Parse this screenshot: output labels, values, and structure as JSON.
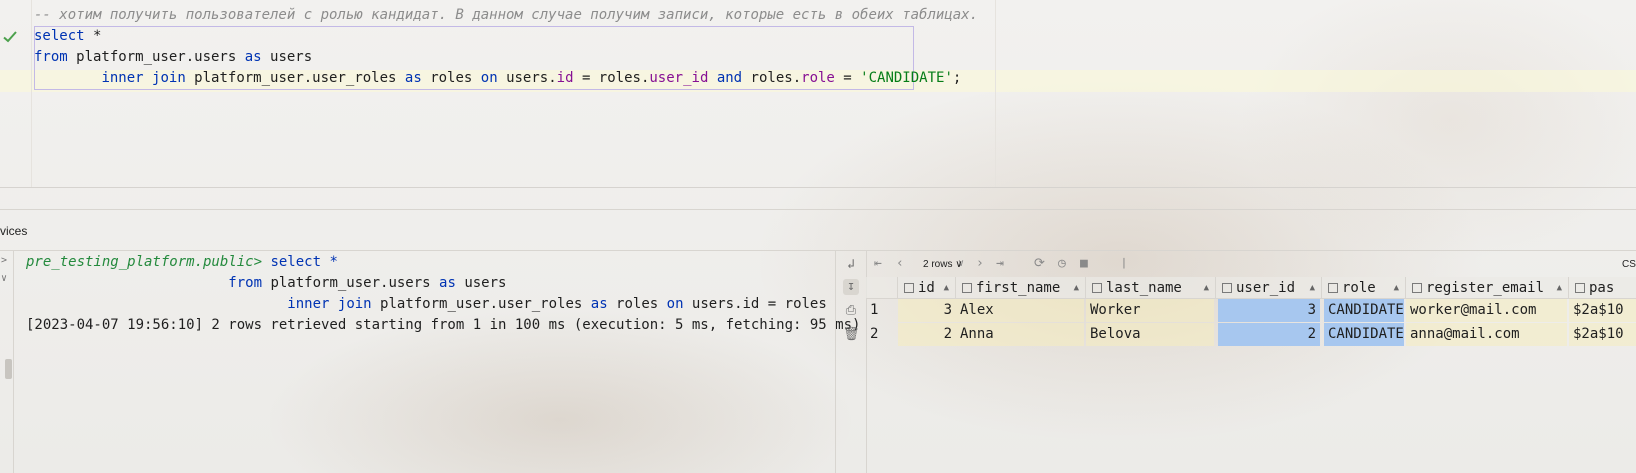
{
  "editor": {
    "comment": "-- хотим получить пользователей с ролью кандидат. В данном случае получим записи, которые есть в обеих таблицах.",
    "line2": {
      "kw": "select",
      "rest": " *"
    },
    "line3": {
      "kw_from": "from",
      "table": " platform_user.users ",
      "kw_as": "as",
      "alias": " users"
    },
    "line4": {
      "kw_inner": "inner",
      "kw_join": "join",
      "table": " platform_user.user_roles ",
      "kw_as": "as",
      "alias": " roles ",
      "kw_on": "on",
      "a": " users.",
      "f_id": "id",
      "eq1": " = roles.",
      "f_user_id": "user_id",
      "sp": " ",
      "kw_and": "and",
      "b": " roles.",
      "f_role": "role",
      "eq2": " = ",
      "str": "'CANDIDATE'",
      "semi": ";"
    }
  },
  "services": {
    "title": "vices"
  },
  "console": {
    "prompt": "pre_testing_platform.public>",
    "l1": " select *",
    "l2_kw": "from",
    "l2_rest": " platform_user.users ",
    "l2_as": "as",
    "l2_alias": " users",
    "l3_inner": "inner",
    "l3_join": "join",
    "l3_rest": " platform_user.user_roles ",
    "l3_as": "as",
    "l3_mid": " roles ",
    "l3_on": "on",
    "l3_tail": " users.id = roles",
    "log": "[2023-04-07 19:56:10] 2 rows retrieved starting from 1 in 100 ms (execution: 5 ms, fetching: 95 ms)"
  },
  "results": {
    "rows_label": "2 rows",
    "csv_label": "CSV",
    "columns": [
      "id",
      "first_name",
      "last_name",
      "user_id",
      "role",
      "register_email",
      "pas"
    ],
    "rows": [
      {
        "num": "1",
        "id": "3",
        "first_name": "Alex",
        "last_name": "Worker",
        "user_id": "3",
        "role": "CANDIDATE",
        "register_email": "worker@mail.com",
        "pas": "$2a$10"
      },
      {
        "num": "2",
        "id": "2",
        "first_name": "Anna",
        "last_name": "Belova",
        "user_id": "2",
        "role": "CANDIDATE",
        "register_email": "anna@mail.com",
        "pas": "$2a$10"
      }
    ]
  },
  "icons": [
    "check-icon",
    "first-page-icon",
    "prev-page-icon",
    "dropdown-icon",
    "next-page-icon",
    "last-page-icon",
    "refresh-icon",
    "history-icon",
    "stop-icon",
    "pin-icon",
    "soft-wrap-icon",
    "scroll-end-icon",
    "print-icon",
    "trash-icon",
    "column-icon",
    "sort-icon"
  ],
  "colors": {
    "keyword": "#0033b3",
    "field": "#871094",
    "string": "#067d17",
    "prompt": "#248a3d",
    "selected_cell": "#a7c7ef"
  }
}
